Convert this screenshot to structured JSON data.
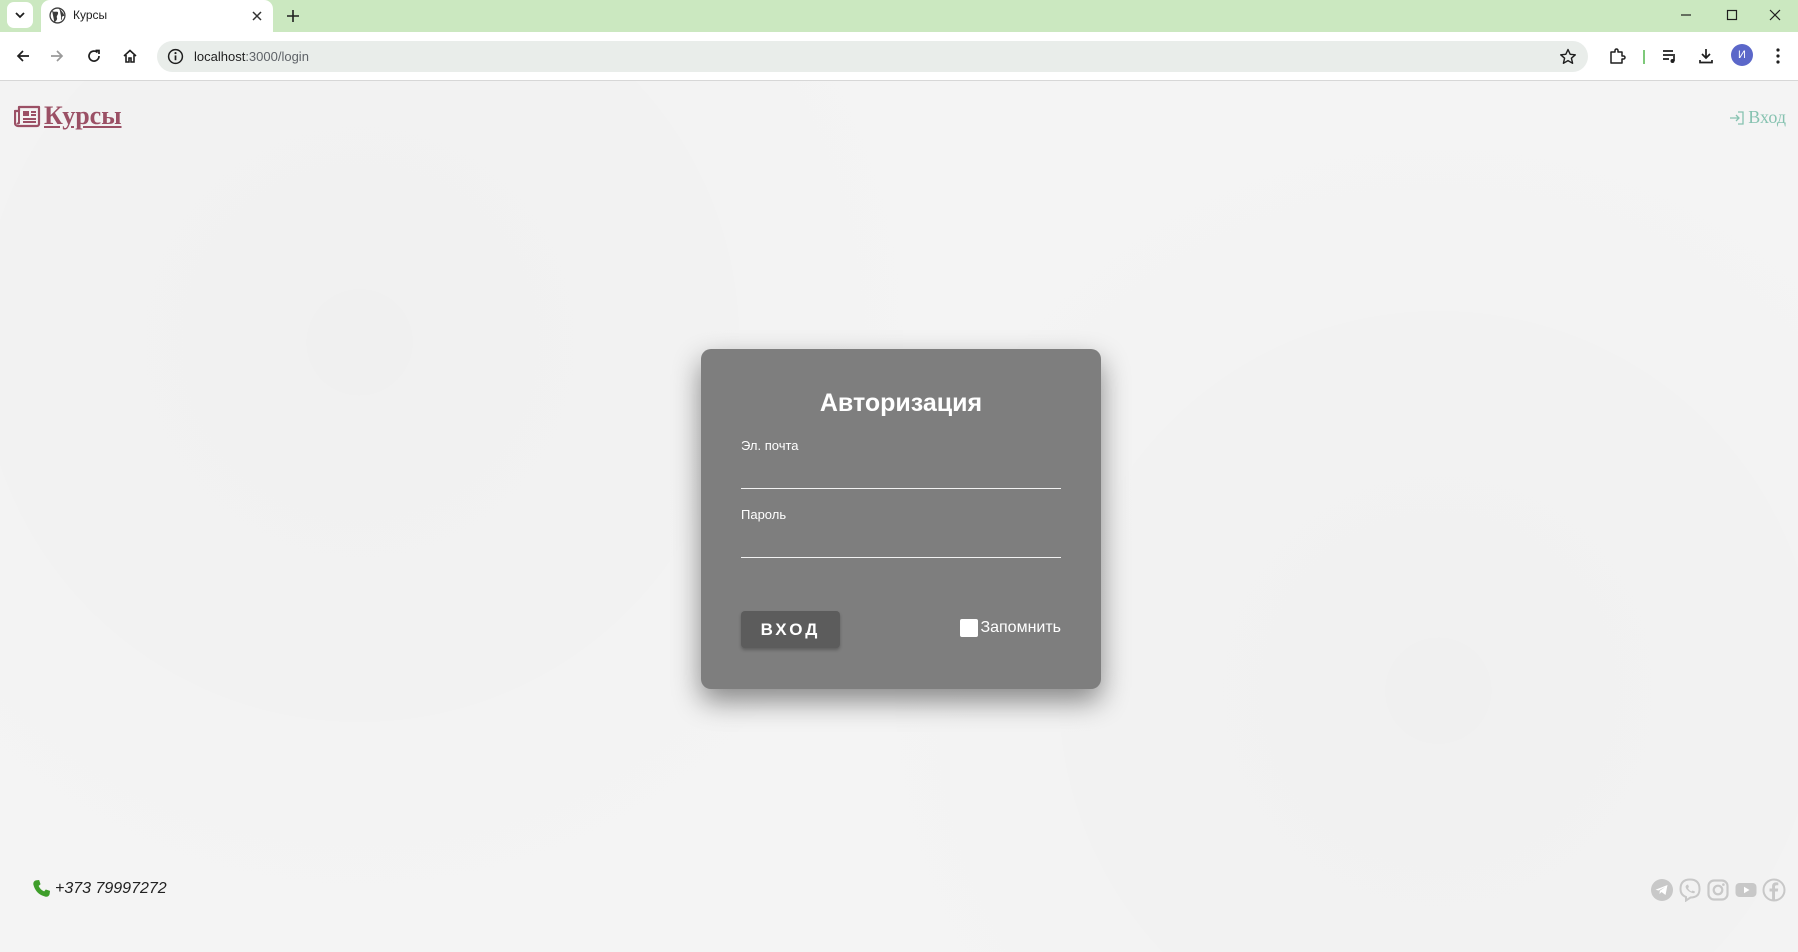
{
  "browser": {
    "tab_title": "Курсы",
    "url_host": "localhost",
    "url_path": ":3000/login",
    "profile_initial": "И"
  },
  "header": {
    "brand_label": "Курсы",
    "login_link_label": "Вход"
  },
  "login_card": {
    "title": "Авторизация",
    "email_label": "Эл. почта",
    "email_value": "",
    "password_label": "Пароль",
    "password_value": "",
    "submit_label": "ВХОД",
    "remember_label": "Запомнить",
    "remember_checked": false
  },
  "footer": {
    "phone": "+373 79997272",
    "socials": [
      "telegram-icon",
      "viber-icon",
      "instagram-icon",
      "youtube-icon",
      "facebook-icon"
    ]
  },
  "colors": {
    "tabstrip": "#cbe8c0",
    "brand": "#9b5065",
    "login_link": "#86c2b0",
    "card": "#7e7e7e",
    "button": "#5c5c5c",
    "phone_icon": "#3e9e2a",
    "social": "#c8c8c8"
  }
}
